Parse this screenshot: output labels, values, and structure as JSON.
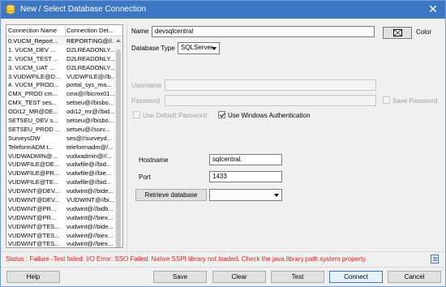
{
  "window": {
    "title": "New / Select Database Connection",
    "close_glyph": "✕",
    "icon": "database-icon"
  },
  "list": {
    "headers": [
      "Connection Name",
      "Connection Det..."
    ],
    "rows": [
      [
        "0.VUCM_Report...",
        "REPORTING@//..."
      ],
      [
        "1. VUCM_DEV  ...",
        "D2LREADONLY..."
      ],
      [
        "2. VUCM_TEST ...",
        "D2LREADONLY..."
      ],
      [
        "3. VUCM_UAT  ...",
        "D2LREADONLY..."
      ],
      [
        "3.VUDWFILE@D...",
        "VUDWFILE@//b..."
      ],
      [
        "4. VUCM_PROD...",
        "portal_sys_rea..."
      ],
      [
        "CMX_PROD  cm...",
        "cmx@//bicmx01..."
      ],
      [
        "CMX_TEST  ses...",
        "setseu@//bisbo..."
      ],
      [
        "ODI12_MR@DE...",
        "odi12_mr@//bid..."
      ],
      [
        "SETSEU_DEV  s...",
        "setseu@//bisbo..."
      ],
      [
        "SETSEU_PROD  ...",
        "setseu@//surv..."
      ],
      [
        "SurveysDW",
        "ses@//surveyd..."
      ],
      [
        "TeleformADM  t...",
        "teleformadm@/..."
      ],
      [
        "VUDWADMIN@...",
        "vudwadmin@//..."
      ],
      [
        "VUDWFILE@DE...",
        "vudwfile@//bid..."
      ],
      [
        "VUDWFILE@PR...",
        "vudwfile@//bie..."
      ],
      [
        "VUDWFILE@TE...",
        "vudwfile@//bid..."
      ],
      [
        "VUDWINT@DEV...",
        "vudwint@//bide..."
      ],
      [
        "VUDWINT@DEV...",
        "VUDWINT@//bi..."
      ],
      [
        "VUDWINT@PR...",
        "vudwint@//bidb..."
      ],
      [
        "VUDWINT@PR...",
        "vudwint@//biex..."
      ],
      [
        "VUDWINT@TES...",
        "vudwint@//bide..."
      ],
      [
        "VUDWINT@TES...",
        "vudwint@//biex..."
      ],
      [
        "VUDWINT@TES...",
        "vudwint@//biex..."
      ]
    ]
  },
  "form": {
    "name_label": "Name",
    "name_value": "devsqlcentral",
    "color_label": "Color",
    "dbtype_label": "Database Type",
    "dbtype_value": "SQLServer",
    "username_label": "Username",
    "password_label": "Password",
    "save_password_label": "Save Password",
    "use_default_password_label": "Use Default Password",
    "use_windows_auth_label": "Use Windows Authentication",
    "hostname_label": "Hostname",
    "hostname_value": "sqlcentral.",
    "port_label": "Port",
    "port_value": "1433",
    "retrieve_db_label": "Retrieve database"
  },
  "status": {
    "text": "Status : Failure -Test failed: I/O Error: SSO Failed: Native SSPI library not loaded. Check the java.library.path system property.",
    "color": "#e02020",
    "icon": "log-icon"
  },
  "buttons": {
    "help": "Help",
    "save": "Save",
    "clear": "Clear",
    "test": "Test",
    "connect": "Connect",
    "cancel": "Cancel"
  }
}
